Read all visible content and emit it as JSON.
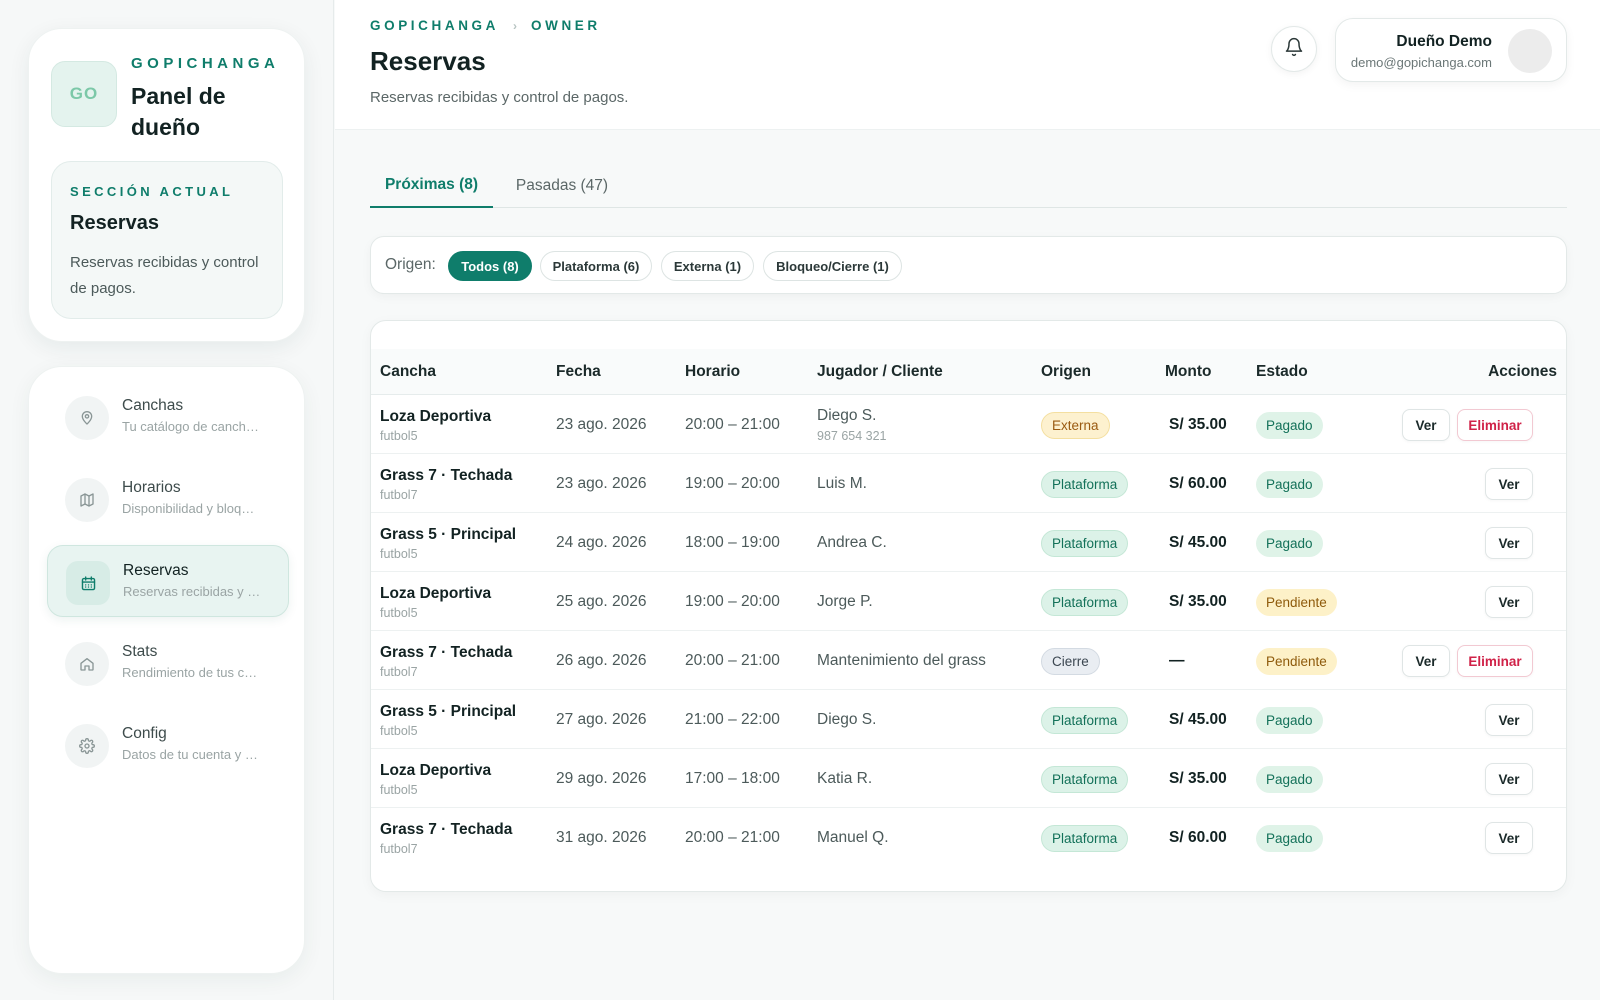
{
  "sidebar": {
    "logo_text": "GO",
    "brand": "GOPICHANGA",
    "title": "Panel de dueño",
    "section_kicker": "SECCIÓN ACTUAL",
    "section_title": "Reservas",
    "section_desc": "Reservas recibidas y control de pagos.",
    "items": [
      {
        "label": "Canchas",
        "sub": "Tu catálogo de canch…",
        "icon": "map-pin-icon"
      },
      {
        "label": "Horarios",
        "sub": "Disponibilidad y bloq…",
        "icon": "map-icon"
      },
      {
        "label": "Reservas",
        "sub": "Reservas recibidas y …",
        "icon": "calendar-icon"
      },
      {
        "label": "Stats",
        "sub": "Rendimiento de tus c…",
        "icon": "home-icon"
      },
      {
        "label": "Config",
        "sub": "Datos de tu cuenta y …",
        "icon": "gear-icon"
      }
    ],
    "active_item": "Reservas"
  },
  "header": {
    "breadcrumb": [
      "GOPICHANGA",
      "OWNER"
    ],
    "title": "Reservas",
    "subtitle": "Reservas recibidas y control de pagos.",
    "user_name": "Dueño Demo",
    "user_email": "demo@gopichanga.com"
  },
  "tabs": [
    {
      "label": "Próximas (8)",
      "active": true
    },
    {
      "label": "Pasadas (47)",
      "active": false
    }
  ],
  "filters": {
    "label": "Origen:",
    "chips": [
      {
        "label": "Todos (8)",
        "active": true
      },
      {
        "label": "Plataforma (6)",
        "active": false
      },
      {
        "label": "Externa (1)",
        "active": false
      },
      {
        "label": "Bloqueo/Cierre (1)",
        "active": false
      }
    ]
  },
  "table": {
    "headers": [
      "Cancha",
      "Fecha",
      "Horario",
      "Jugador / Cliente",
      "Origen",
      "Monto",
      "Estado",
      "Acciones"
    ],
    "rows": [
      {
        "court": "Loza Deportiva",
        "court_type": "futbol5",
        "date": "23 ago. 2026",
        "time": "20:00 – 21:00",
        "player": "Diego S.",
        "phone": "987 654 321",
        "origin": "Externa",
        "amount": "S/ 35.00",
        "status": "Pagado",
        "actions": [
          "Ver",
          "Eliminar"
        ]
      },
      {
        "court": "Grass 7 · Techada",
        "court_type": "futbol7",
        "date": "23 ago. 2026",
        "time": "19:00 – 20:00",
        "player": "Luis M.",
        "phone": "",
        "origin": "Plataforma",
        "amount": "S/ 60.00",
        "status": "Pagado",
        "actions": [
          "Ver"
        ]
      },
      {
        "court": "Grass 5 · Principal",
        "court_type": "futbol5",
        "date": "24 ago. 2026",
        "time": "18:00 – 19:00",
        "player": "Andrea C.",
        "phone": "",
        "origin": "Plataforma",
        "amount": "S/ 45.00",
        "status": "Pagado",
        "actions": [
          "Ver"
        ]
      },
      {
        "court": "Loza Deportiva",
        "court_type": "futbol5",
        "date": "25 ago. 2026",
        "time": "19:00 – 20:00",
        "player": "Jorge P.",
        "phone": "",
        "origin": "Plataforma",
        "amount": "S/ 35.00",
        "status": "Pendiente",
        "actions": [
          "Ver"
        ]
      },
      {
        "court": "Grass 7 · Techada",
        "court_type": "futbol7",
        "date": "26 ago. 2026",
        "time": "20:00 – 21:00",
        "player": "Mantenimiento del grass",
        "phone": "",
        "origin": "Cierre",
        "amount": "—",
        "status": "Pendiente",
        "actions": [
          "Ver",
          "Eliminar"
        ]
      },
      {
        "court": "Grass 5 · Principal",
        "court_type": "futbol5",
        "date": "27 ago. 2026",
        "time": "21:00 – 22:00",
        "player": "Diego S.",
        "phone": "",
        "origin": "Plataforma",
        "amount": "S/ 45.00",
        "status": "Pagado",
        "actions": [
          "Ver"
        ]
      },
      {
        "court": "Loza Deportiva",
        "court_type": "futbol5",
        "date": "29 ago. 2026",
        "time": "17:00 – 18:00",
        "player": "Katia R.",
        "phone": "",
        "origin": "Plataforma",
        "amount": "S/ 35.00",
        "status": "Pagado",
        "actions": [
          "Ver"
        ]
      },
      {
        "court": "Grass 7 · Techada",
        "court_type": "futbol7",
        "date": "31 ago. 2026",
        "time": "20:00 – 21:00",
        "player": "Manuel Q.",
        "phone": "",
        "origin": "Plataforma",
        "amount": "S/ 60.00",
        "status": "Pagado",
        "actions": [
          "Ver"
        ]
      }
    ]
  },
  "colors": {
    "brand": "#0f7d6b",
    "danger": "#d02248",
    "pending": "#8e5a0b"
  }
}
